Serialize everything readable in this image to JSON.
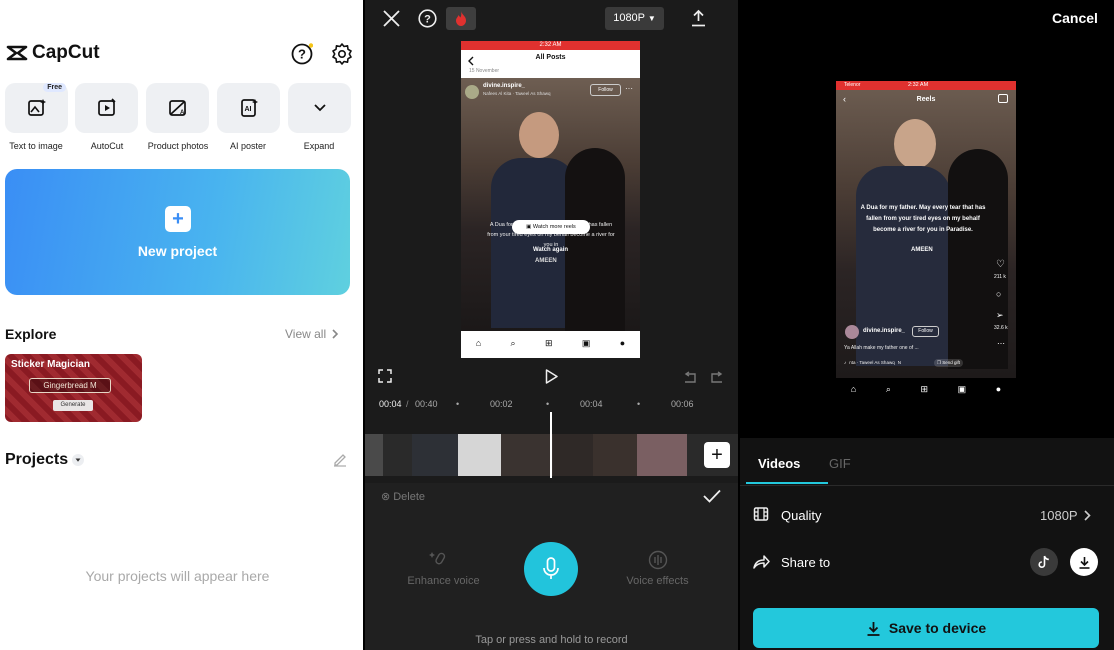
{
  "home": {
    "app_name": "CapCut",
    "tools": [
      {
        "label": "Text to image",
        "badge": "Free"
      },
      {
        "label": "AutoCut"
      },
      {
        "label": "Product photos"
      },
      {
        "label": "AI poster"
      },
      {
        "label": "Expand"
      }
    ],
    "new_project_label": "New project",
    "explore_title": "Explore",
    "view_all_label": "View all",
    "explore_card": {
      "title": "Sticker Magician",
      "subtitle": "Gingerbread M",
      "button": "Generate"
    },
    "projects_title": "Projects",
    "empty_projects_text": "Your projects will appear here"
  },
  "editor": {
    "resolution_label": "1080P",
    "status_time": "2:32 AM",
    "post": {
      "header": "All Posts",
      "date": "15 November",
      "username": "divine.inspire_",
      "audio": "Nafees Al Kita · Taweel As Shawq",
      "follow_label": "Follow",
      "watch_more_label": "Watch more reels",
      "watch_again_label": "Watch again",
      "caption": "A Dua for my father. May every tear that has fallen from your tired eyes on my behalf become a river for you in",
      "ameen": "AMEEN"
    },
    "current_time": "00:04",
    "total_time": "00:40",
    "ticks": [
      "00:02",
      "00:04",
      "00:06"
    ],
    "delete_label": "Delete",
    "enhance_voice_label": "Enhance voice",
    "voice_effects_label": "Voice effects",
    "record_hint": "Tap or press and hold to record"
  },
  "export": {
    "cancel_label": "Cancel",
    "preview": {
      "carrier": "Telenor",
      "status_time": "2:32 AM",
      "reels_label": "Reels",
      "caption": "A Dua for my father. May every tear that has fallen from your tired eyes on my behalf become a river for you in Paradise.",
      "ameen": "AMEEN",
      "like_count": "211 k",
      "share_count": "32.6 k",
      "username": "divine.inspire_",
      "follow_label": "Follow",
      "desc": "Ya Allah make my father one of ...",
      "audio": "nta · Taweel As Shawq",
      "audio_tag": "N",
      "gift_label": "Send gift"
    },
    "tabs": [
      "Videos",
      "GIF"
    ],
    "quality_label": "Quality",
    "quality_value": "1080P",
    "share_to_label": "Share to",
    "save_label": "Save to device"
  },
  "colors": {
    "accent": "#23c8dc",
    "record_red": "#e0312f",
    "blue_start": "#3a8ef5"
  }
}
